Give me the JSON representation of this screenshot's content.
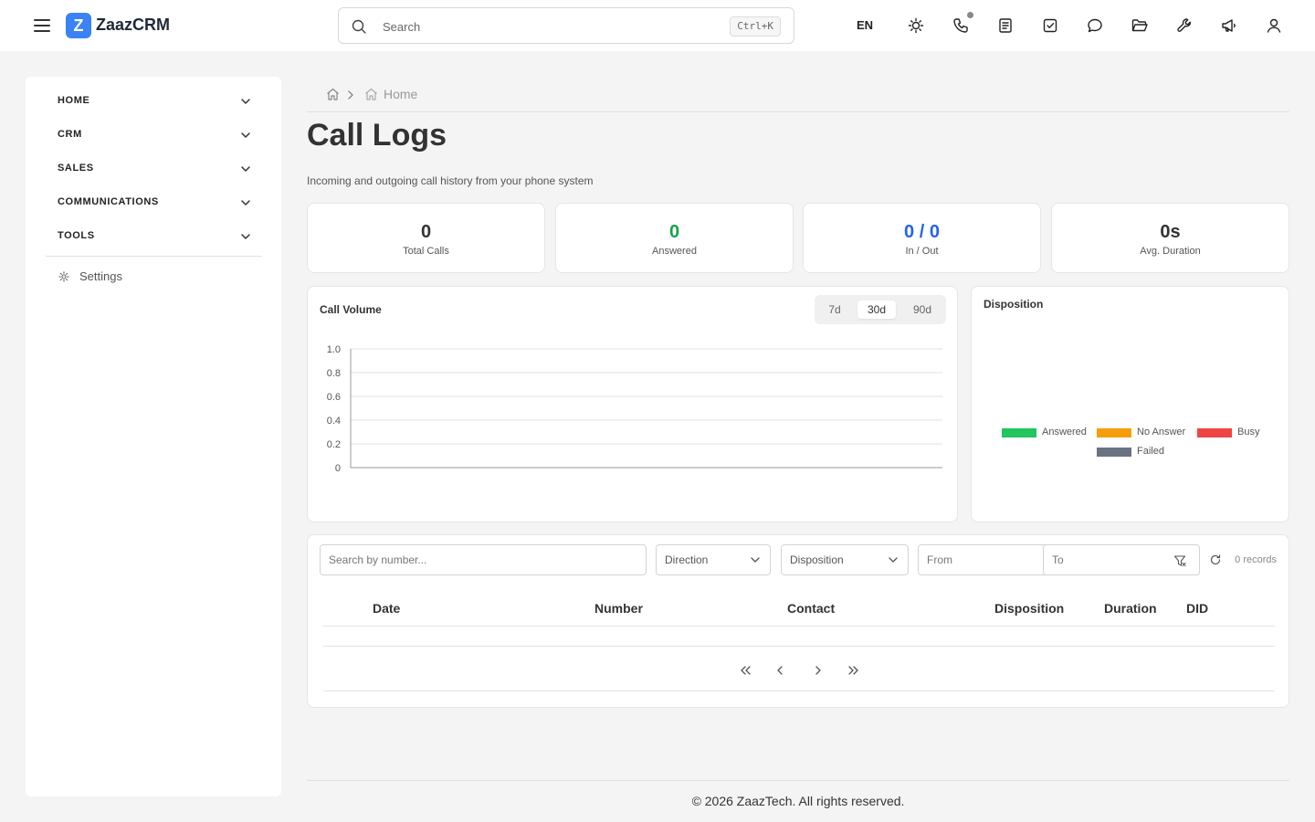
{
  "header": {
    "brand_initial": "Z",
    "brand": "ZaazCRM",
    "search_placeholder": "Search",
    "shortcut": "Ctrl+K",
    "language": "EN",
    "icons": [
      "menu-icon",
      "sun-icon",
      "phone-icon",
      "document-icon",
      "checkbox-icon",
      "chat-icon",
      "folder-icon",
      "wrench-icon",
      "megaphone-icon",
      "user-icon"
    ]
  },
  "sidebar": {
    "items": [
      {
        "label": "HOME"
      },
      {
        "label": "CRM"
      },
      {
        "label": "SALES"
      },
      {
        "label": "COMMUNICATIONS"
      },
      {
        "label": "TOOLS"
      }
    ],
    "settings_label": "Settings"
  },
  "breadcrumb": {
    "current": "Home"
  },
  "page": {
    "title": "Call Logs",
    "subtitle": "Incoming and outgoing call history from your phone system"
  },
  "stats": [
    {
      "value": "0",
      "label": "Total Calls",
      "color": "#333333"
    },
    {
      "value": "0",
      "label": "Answered",
      "color": "#16a34a"
    },
    {
      "value": "0 / 0",
      "label": "In / Out",
      "color": "#2563eb"
    },
    {
      "value": "0s",
      "label": "Avg. Duration",
      "color": "#333333"
    }
  ],
  "call_volume": {
    "title": "Call Volume",
    "ranges": [
      "7d",
      "30d",
      "90d"
    ],
    "active_range": "30d"
  },
  "chart_data": [
    {
      "type": "line",
      "title": "Call Volume",
      "x": [],
      "series": [],
      "ylim": [
        0,
        1
      ],
      "yticks": [
        "1.0",
        "0.8",
        "0.6",
        "0.4",
        "0.2",
        "0"
      ],
      "grid": true
    },
    {
      "type": "pie",
      "title": "Disposition",
      "categories": [
        "Answered",
        "No Answer",
        "Busy",
        "Failed"
      ],
      "values": [
        0,
        0,
        0,
        0
      ],
      "colors": [
        "#22c55e",
        "#f59e0b",
        "#ef4444",
        "#6b7280"
      ],
      "legend": "center"
    }
  ],
  "disposition": {
    "title": "Disposition",
    "legend": [
      {
        "label": "Answered",
        "color": "#22c55e"
      },
      {
        "label": "No Answer",
        "color": "#f59e0b"
      },
      {
        "label": "Busy",
        "color": "#ef4444"
      },
      {
        "label": "Failed",
        "color": "#6b7280"
      }
    ]
  },
  "table": {
    "search_placeholder": "Search by number...",
    "direction_label": "Direction",
    "disposition_label": "Disposition",
    "from_placeholder": "From",
    "to_placeholder": "To",
    "records": "0 records",
    "columns": [
      "Date",
      "Number",
      "Contact",
      "Disposition",
      "Duration",
      "DID"
    ],
    "rows": []
  },
  "footer": {
    "text": "© 2026 ZaazTech. All rights reserved."
  }
}
